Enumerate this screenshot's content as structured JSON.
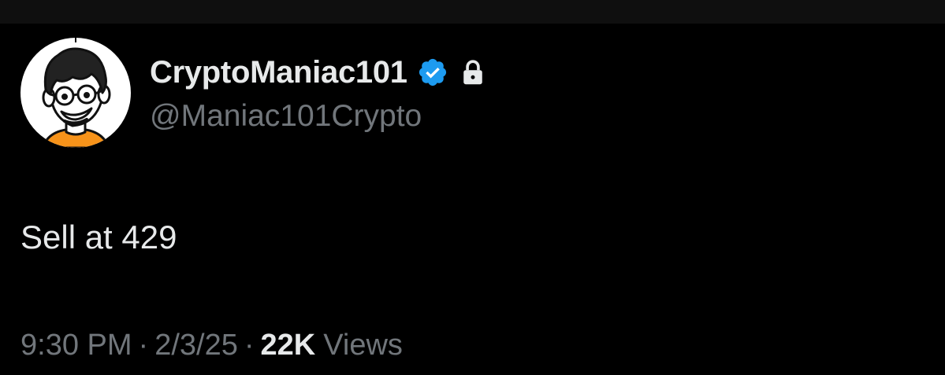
{
  "tweet": {
    "author": {
      "display_name": "CryptoManiac101",
      "handle": "@Maniac101Crypto",
      "avatar": "cartoon-man-with-glasses-avatar",
      "verified_icon": "verified-badge-icon",
      "protected_icon": "lock-icon"
    },
    "text": "Sell at 429",
    "time": "9:30 PM",
    "date": "2/3/25",
    "separator": "·",
    "views_count": "22K",
    "views_label": "Views"
  },
  "colors": {
    "background": "#000000",
    "primary_text": "#e7e9ea",
    "secondary_text": "#71767b",
    "verified_blue": "#1d9bf0",
    "avatar_shirt": "#f7931a"
  }
}
